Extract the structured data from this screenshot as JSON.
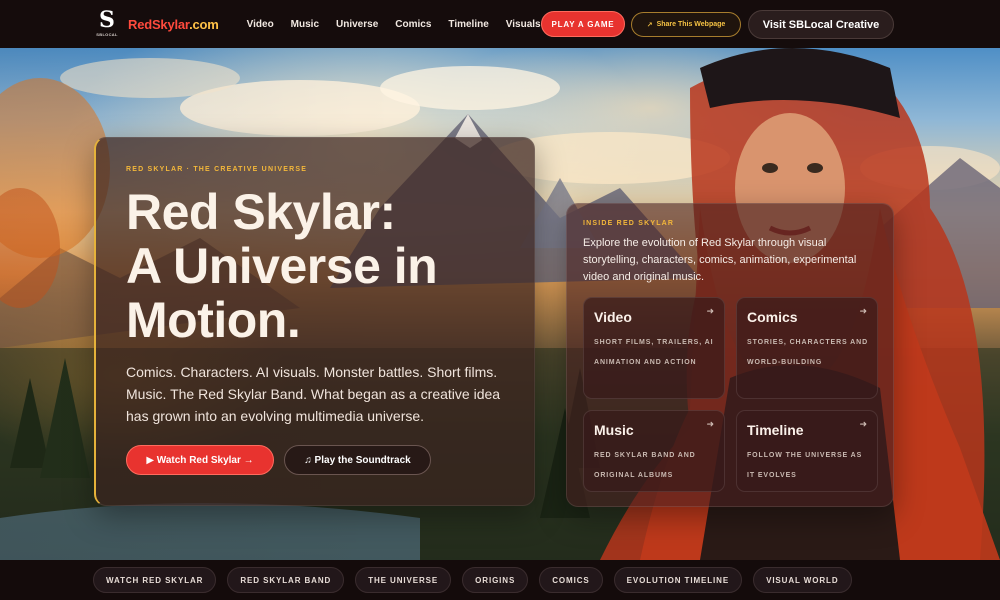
{
  "brand": {
    "logo_letter": "S",
    "logo_sub": "SBLOCAL",
    "name_red": "RedSkylar",
    "name_gold": ".com"
  },
  "nav": {
    "links": [
      "Video",
      "Music",
      "Universe",
      "Comics",
      "Timeline",
      "Visuals"
    ],
    "play_label": "PLAY A GAME",
    "share_label": "Share This Webpage",
    "visit_label": "Visit SBLocal Creative"
  },
  "hero": {
    "eyebrow": "RED SKYLAR · THE CREATIVE UNIVERSE",
    "title_lines": [
      "Red Skylar:",
      "A Universe in",
      "Motion."
    ],
    "description": "Comics. Characters. AI visuals. Monster battles. Short films. Music. The Red Skylar Band. What began as a creative idea has grown into an evolving multimedia universe.",
    "watch_label": "▶ Watch Red Skylar →",
    "sound_label": "♫ Play the Soundtrack"
  },
  "inside": {
    "eyebrow": "INSIDE RED SKYLAR",
    "description": "Explore the evolution of Red Skylar through visual storytelling, characters, comics, animation, experimental video and original music.",
    "tiles": [
      {
        "title": "Video",
        "desc": "SHORT FILMS, TRAILERS, AI ANIMATION AND ACTION"
      },
      {
        "title": "Comics",
        "desc": "STORIES, CHARACTERS AND WORLD-BUILDING"
      },
      {
        "title": "Music",
        "desc": "RED SKYLAR BAND AND ORIGINAL ALBUMS"
      },
      {
        "title": "Timeline",
        "desc": "FOLLOW THE UNIVERSE AS IT EVOLVES"
      }
    ]
  },
  "chips": [
    "WATCH RED SKYLAR",
    "RED SKYLAR BAND",
    "THE UNIVERSE",
    "ORIGINS",
    "COMICS",
    "EVOLUTION TIMELINE",
    "VISUAL WORLD"
  ],
  "colors": {
    "accent_red": "#e8332f",
    "accent_gold": "#f3b73a",
    "nav_bg": "#150c0c"
  }
}
